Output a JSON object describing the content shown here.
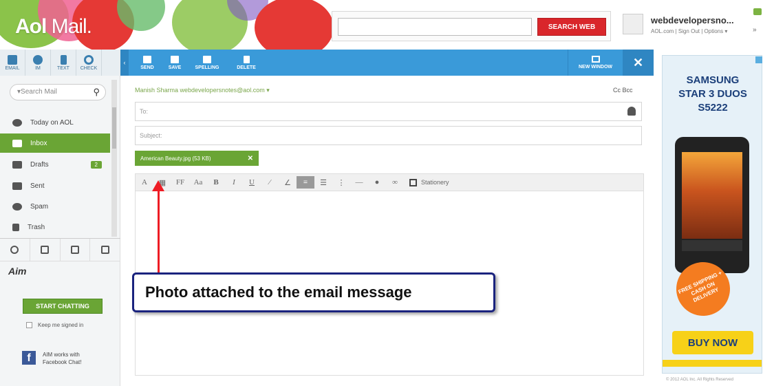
{
  "header": {
    "logo_brand": "Aol",
    "logo_product": "Mail.",
    "search": {
      "placeholder": "",
      "button_label": "SEARCH WEB"
    },
    "user": {
      "name": "webdevelopersno...",
      "links": "AOL.com | Sign Out | Options ▾"
    },
    "colors": {
      "search_button": "#d9262b",
      "accent_green": "#6aa535",
      "toolbar_blue": "#3a9ad9"
    }
  },
  "left_toolbar": {
    "items": [
      {
        "label": "EMAIL",
        "icon": "compose-icon"
      },
      {
        "label": "IM",
        "icon": "chat-icon"
      },
      {
        "label": "TEXT",
        "icon": "phone-icon"
      },
      {
        "label": "CHECK",
        "icon": "refresh-icon"
      }
    ]
  },
  "sidebar": {
    "search_placeholder": "▾Search Mail",
    "folders": [
      {
        "label": "Today on AOL",
        "icon": "aol-icon"
      },
      {
        "label": "Inbox",
        "icon": "inbox-icon",
        "active": true
      },
      {
        "label": "Drafts",
        "icon": "drafts-icon",
        "count": "2"
      },
      {
        "label": "Sent",
        "icon": "sent-icon"
      },
      {
        "label": "Spam",
        "icon": "spam-icon"
      },
      {
        "label": "Trash",
        "icon": "trash-icon"
      }
    ],
    "aim": {
      "logo": "Aim",
      "start_chatting": "START CHATTING",
      "keep_signed_in": "Keep me signed in",
      "fb_text": "AIM works with Facebook Chat!"
    }
  },
  "compose_toolbar": {
    "buttons": [
      {
        "label": "SEND",
        "icon": "send-icon"
      },
      {
        "label": "SAVE",
        "icon": "save-icon"
      },
      {
        "label": "SPELLING",
        "icon": "spellcheck-icon"
      },
      {
        "label": "DELETE",
        "icon": "delete-icon"
      }
    ],
    "new_window": "NEW WINDOW",
    "close": "✕"
  },
  "compose": {
    "from": "Manish Sharma  webdevelopersnotes@aol.com ▾",
    "cc_bcc": "Cc  Bcc",
    "to_placeholder": "To:",
    "subject_placeholder": "Subject:",
    "attachment": "American Beauty.jpg (53 KB)",
    "format_tools": [
      "A",
      "▦",
      "FF",
      "Aa",
      "B",
      "I",
      "U",
      "⁄",
      "∠",
      "≡",
      "☰",
      "⋮",
      "—",
      "●",
      "∞"
    ],
    "stationery": "Stationery"
  },
  "annotation": {
    "text": "Photo attached to the email message",
    "arrow_color": "#ee1c24",
    "border_color": "#1a237e"
  },
  "ad": {
    "brand_line1": "SAMSUNG",
    "brand_line2": "STAR 3 DUOS",
    "brand_line3": "S5222",
    "promo": "FREE SHIPPING + CASH ON DELIVERY",
    "buy_now": "BUY NOW",
    "footer": "© 2012 AOL Inc. All Rights Reserved"
  }
}
